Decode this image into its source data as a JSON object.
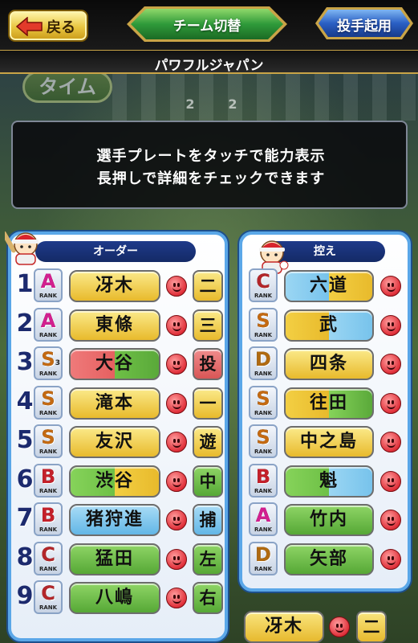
{
  "header": {
    "back_label": "戻る",
    "team_switch_label": "チーム切替",
    "pitcher_label": "投手起用",
    "team_name": "パワフルジャパン"
  },
  "background": {
    "time_label": "タイム",
    "score_left": "2",
    "score_right": "2"
  },
  "tooltip": {
    "line1": "選手プレートをタッチで能力表示",
    "line2": "長押しで詳細をチェックできます"
  },
  "order_panel": {
    "title": "オーダー",
    "rows": [
      {
        "num": "1",
        "rank": "A",
        "rank_sub": "RANK",
        "name": "冴木",
        "pos": "二"
      },
      {
        "num": "2",
        "rank": "A",
        "rank_sub": "RANK",
        "name": "東條",
        "pos": "三"
      },
      {
        "num": "3",
        "rank": "S",
        "rank_sub": "RANK",
        "rank_sup": "3",
        "name": "大谷",
        "pos": "投"
      },
      {
        "num": "4",
        "rank": "S",
        "rank_sub": "RANK",
        "name": "滝本",
        "pos": "一"
      },
      {
        "num": "5",
        "rank": "S",
        "rank_sub": "RANK",
        "name": "友沢",
        "pos": "遊"
      },
      {
        "num": "6",
        "rank": "B",
        "rank_sub": "RANK",
        "name": "渋谷",
        "pos": "中"
      },
      {
        "num": "7",
        "rank": "B",
        "rank_sub": "RANK",
        "name": "猪狩進",
        "pos": "捕"
      },
      {
        "num": "8",
        "rank": "C",
        "rank_sub": "RANK",
        "name": "猛田",
        "pos": "左"
      },
      {
        "num": "9",
        "rank": "C",
        "rank_sub": "RANK",
        "name": "八嶋",
        "pos": "右"
      }
    ]
  },
  "bench_panel": {
    "title": "控え",
    "rows": [
      {
        "rank": "C",
        "rank_sub": "RANK",
        "name": "六道"
      },
      {
        "rank": "S",
        "rank_sub": "RANK",
        "name": "武"
      },
      {
        "rank": "D",
        "rank_sub": "RANK",
        "name": "四条"
      },
      {
        "rank": "S",
        "rank_sub": "RANK",
        "name": "往田"
      },
      {
        "rank": "S",
        "rank_sub": "RANK",
        "name": "中之島"
      },
      {
        "rank": "B",
        "rank_sub": "RANK",
        "name": "魁"
      },
      {
        "rank": "A",
        "rank_sub": "RANK",
        "name": "竹内"
      },
      {
        "rank": "D",
        "rank_sub": "RANK",
        "name": "矢部"
      }
    ]
  },
  "bottom_peek": {
    "name": "冴木",
    "pos": "二"
  },
  "colors": {
    "rank_A": "#d21f8f",
    "rank_S": "#c46a12",
    "rank_B": "#c4202a",
    "rank_C": "#b3262a",
    "rank_D": "#b06a10",
    "plate_yellow": "#f5d24a",
    "plate_green": "#6ec046",
    "plate_blue": "#7cc7ee",
    "plate_red": "#e46464"
  }
}
